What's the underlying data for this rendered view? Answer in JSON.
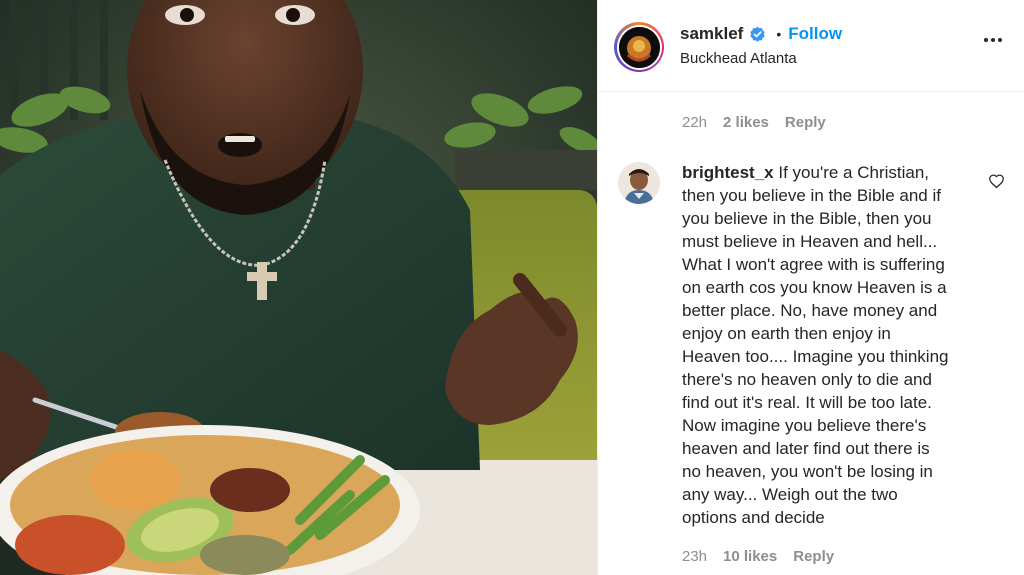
{
  "post": {
    "username": "samklef",
    "separator": "•",
    "follow_label": "Follow",
    "location": "Buckhead Atlanta",
    "more_icon": "more-options-icon",
    "verified_icon": "verified-badge-icon",
    "accent_color": "#0095f6"
  },
  "previous_comment_meta": {
    "time": "22h",
    "likes": "2 likes",
    "reply_label": "Reply"
  },
  "comment": {
    "username": "brightest_x",
    "text": "If you're a Christian,\nthen you believe in the Bible and if\nyou believe in the Bible, then you\nmust believe in Heaven and hell...\nWhat I won't agree with is suffering\non earth cos you know Heaven is a\nbetter place. No, have money and\nenjoy on earth then enjoy in\nHeaven too.... Imagine you thinking\nthere's no heaven only to die and\nfind out it's real. It will be too late.\nNow imagine you believe there's\nheaven and later find out there is\nno heaven, you won't be losing in\nany way... Weigh out the two\noptions and decide",
    "time": "23h",
    "likes": "10 likes",
    "reply_label": "Reply",
    "like_icon": "heart-outline-icon"
  }
}
